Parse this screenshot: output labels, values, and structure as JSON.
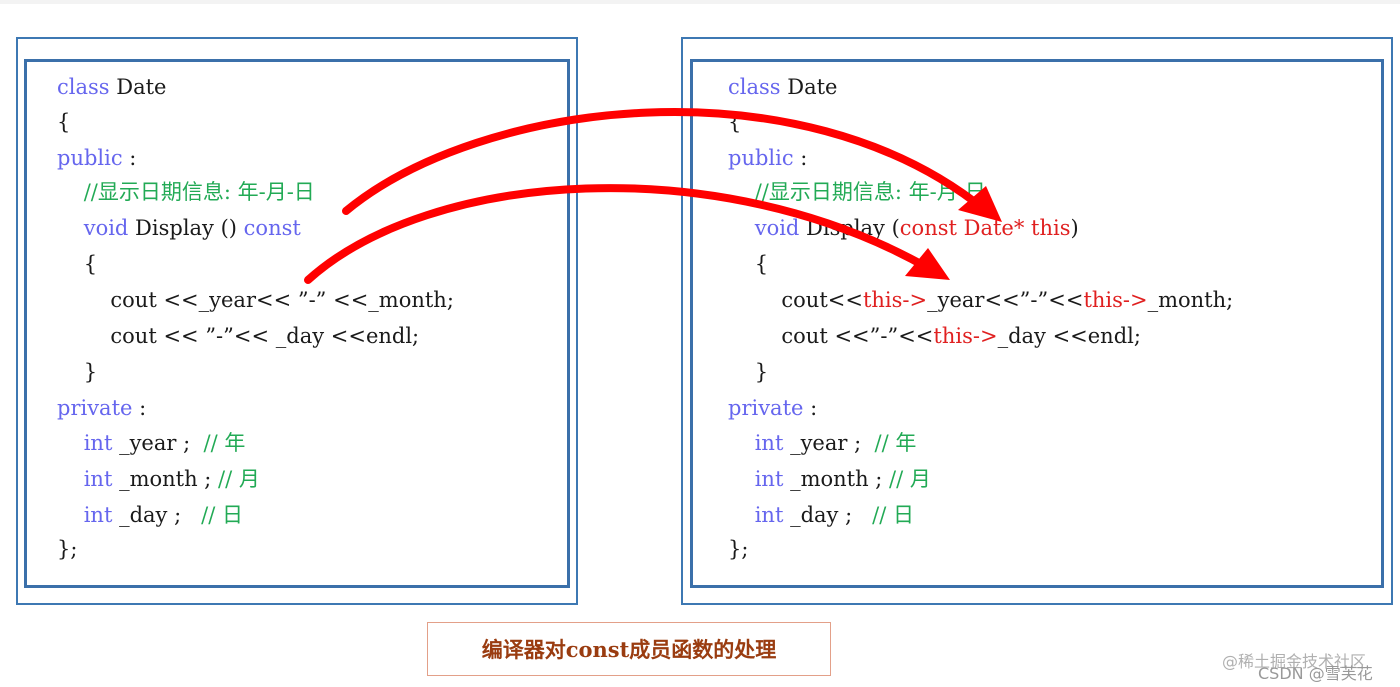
{
  "left_panel": {
    "lines": [
      [
        {
          "t": "class",
          "c": "kw"
        },
        {
          "t": " Date",
          "c": ""
        }
      ],
      [
        {
          "t": "{",
          "c": ""
        }
      ],
      [
        {
          "t": "public",
          "c": "kw"
        },
        {
          "t": " :",
          "c": ""
        }
      ],
      [
        {
          "t": "    //显示日期信息: 年-月-日",
          "c": "cm"
        }
      ],
      [
        {
          "t": "    ",
          "c": ""
        },
        {
          "t": "void",
          "c": "kw"
        },
        {
          "t": " Display () ",
          "c": ""
        },
        {
          "t": "const",
          "c": "kw"
        }
      ],
      [
        {
          "t": "    {",
          "c": ""
        }
      ],
      [
        {
          "t": "        cout <<_year<< ”-” <<_month;",
          "c": ""
        }
      ],
      [
        {
          "t": "        cout << ”-”<< _day <<endl;",
          "c": ""
        }
      ],
      [
        {
          "t": "    }",
          "c": ""
        }
      ],
      [
        {
          "t": "private",
          "c": "kw"
        },
        {
          "t": " :",
          "c": ""
        }
      ],
      [
        {
          "t": "    ",
          "c": ""
        },
        {
          "t": "int",
          "c": "kw"
        },
        {
          "t": " _year ;  ",
          "c": ""
        },
        {
          "t": "// 年",
          "c": "cm"
        }
      ],
      [
        {
          "t": "    ",
          "c": ""
        },
        {
          "t": "int",
          "c": "kw"
        },
        {
          "t": " _month ; ",
          "c": ""
        },
        {
          "t": "// 月",
          "c": "cm"
        }
      ],
      [
        {
          "t": "    ",
          "c": ""
        },
        {
          "t": "int",
          "c": "kw"
        },
        {
          "t": " _day ;   ",
          "c": ""
        },
        {
          "t": "// 日",
          "c": "cm"
        }
      ],
      [
        {
          "t": "};",
          "c": ""
        }
      ]
    ]
  },
  "right_panel": {
    "lines": [
      [
        {
          "t": "class",
          "c": "kw"
        },
        {
          "t": " Date",
          "c": ""
        }
      ],
      [
        {
          "t": "{",
          "c": ""
        }
      ],
      [
        {
          "t": "public",
          "c": "kw"
        },
        {
          "t": " :",
          "c": ""
        }
      ],
      [
        {
          "t": "    //显示日期信息: 年-月-日",
          "c": "cm"
        }
      ],
      [
        {
          "t": "    ",
          "c": ""
        },
        {
          "t": "void",
          "c": "kw"
        },
        {
          "t": " Display (",
          "c": ""
        },
        {
          "t": "const Date* this",
          "c": "red"
        },
        {
          "t": ")",
          "c": ""
        }
      ],
      [
        {
          "t": "    {",
          "c": ""
        }
      ],
      [
        {
          "t": "        cout<<",
          "c": ""
        },
        {
          "t": "this->",
          "c": "red"
        },
        {
          "t": "_year<<”-”<<",
          "c": ""
        },
        {
          "t": "this->",
          "c": "red"
        },
        {
          "t": "_month;",
          "c": ""
        }
      ],
      [
        {
          "t": "        cout <<”-”<<",
          "c": ""
        },
        {
          "t": "this->",
          "c": "red"
        },
        {
          "t": "_day <<endl;",
          "c": ""
        }
      ],
      [
        {
          "t": "    }",
          "c": ""
        }
      ],
      [
        {
          "t": "private",
          "c": "kw"
        },
        {
          "t": " :",
          "c": ""
        }
      ],
      [
        {
          "t": "    ",
          "c": ""
        },
        {
          "t": "int",
          "c": "kw"
        },
        {
          "t": " _year ;  ",
          "c": ""
        },
        {
          "t": "// 年",
          "c": "cm"
        }
      ],
      [
        {
          "t": "    ",
          "c": ""
        },
        {
          "t": "int",
          "c": "kw"
        },
        {
          "t": " _month ; ",
          "c": ""
        },
        {
          "t": "// 月",
          "c": "cm"
        }
      ],
      [
        {
          "t": "    ",
          "c": ""
        },
        {
          "t": "int",
          "c": "kw"
        },
        {
          "t": " _day ;   ",
          "c": ""
        },
        {
          "t": "// 日",
          "c": "cm"
        }
      ],
      [
        {
          "t": "};",
          "c": ""
        }
      ]
    ]
  },
  "caption": "编译器对const成员函数的处理",
  "watermarks": {
    "juejin": "@稀土掘金技术社区",
    "csdn": "CSDN @雪芙花"
  },
  "arrows": [
    {
      "from": "const (left Display)",
      "to": "const Date* this (right Display)"
    },
    {
      "from": "_year (left cout)",
      "to": "this-> (right cout)"
    }
  ],
  "colors": {
    "keyword": "#6666ee",
    "comment": "#22aa55",
    "highlight": "#e02020",
    "border": "#3b70aa",
    "caption": "#9a3c10"
  }
}
